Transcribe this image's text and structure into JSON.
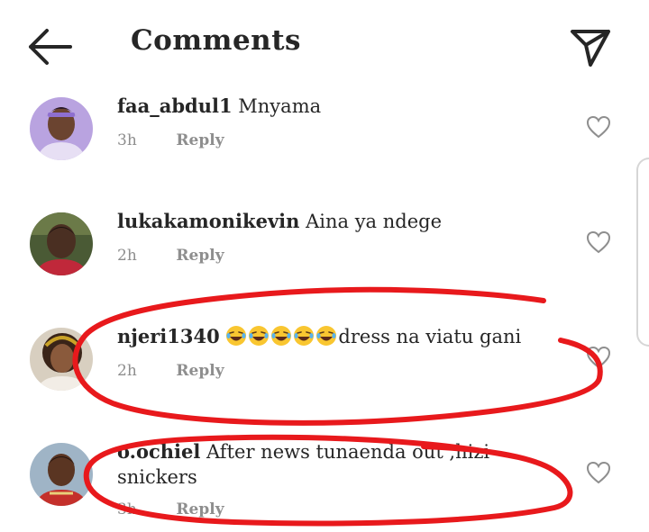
{
  "header": {
    "title": "Comments",
    "back_icon": "arrow-left-icon",
    "send_icon": "paper-plane-icon"
  },
  "comments": [
    {
      "username": "faa_abdul1",
      "text": "Mnyama",
      "time": "3h",
      "reply_label": "Reply"
    },
    {
      "username": "lukakamonikevin",
      "text": "Aina ya ndege",
      "time": "2h",
      "reply_label": "Reply"
    },
    {
      "username": "njeri1340",
      "emoji": "😂😂😂😂😂",
      "text": "dress na viatu gani",
      "time": "2h",
      "reply_label": "Reply"
    },
    {
      "username": "o.ochiel",
      "text": "After news tunaenda out ,hizi snickers",
      "time": "3h",
      "reply_label": "Reply"
    }
  ],
  "colors": {
    "text": "#262626",
    "meta": "#8e8e8e",
    "annotation": "#e8191c"
  }
}
